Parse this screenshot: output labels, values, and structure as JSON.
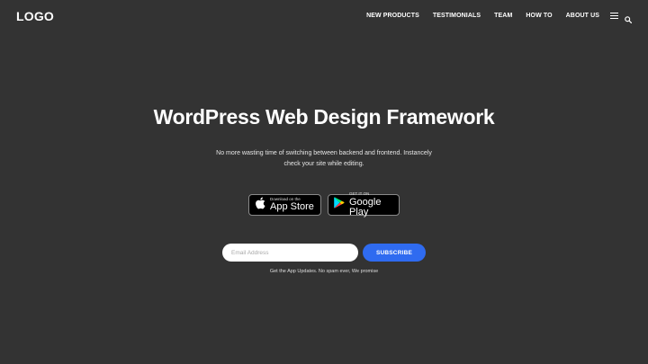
{
  "header": {
    "logo": "LOGO",
    "nav": [
      "NEW PRODUCTS",
      "TESTIMONIALS",
      "TEAM",
      "HOW TO",
      "ABOUT US"
    ],
    "menu_icon": "hamburger-menu-icon",
    "search_icon": "search-icon"
  },
  "hero": {
    "title": "WordPress Web Design Framework",
    "subtitle": "No more wasting time of switching between backend and frontend. Instancely check your site while editing."
  },
  "stores": {
    "appstore": {
      "small": "Download on the",
      "big": "App Store",
      "icon": "apple-icon"
    },
    "googleplay": {
      "small": "GET IT ON",
      "big": "Google Play",
      "icon": "google-play-icon"
    }
  },
  "subscribe": {
    "placeholder": "Email Address",
    "value": "",
    "button_label": "SUBSCRIBE",
    "note": "Get the App Updates. No spam ever, We promise"
  },
  "colors": {
    "background": "#333333",
    "accent": "#2f6bf0",
    "text": "#ffffff"
  }
}
